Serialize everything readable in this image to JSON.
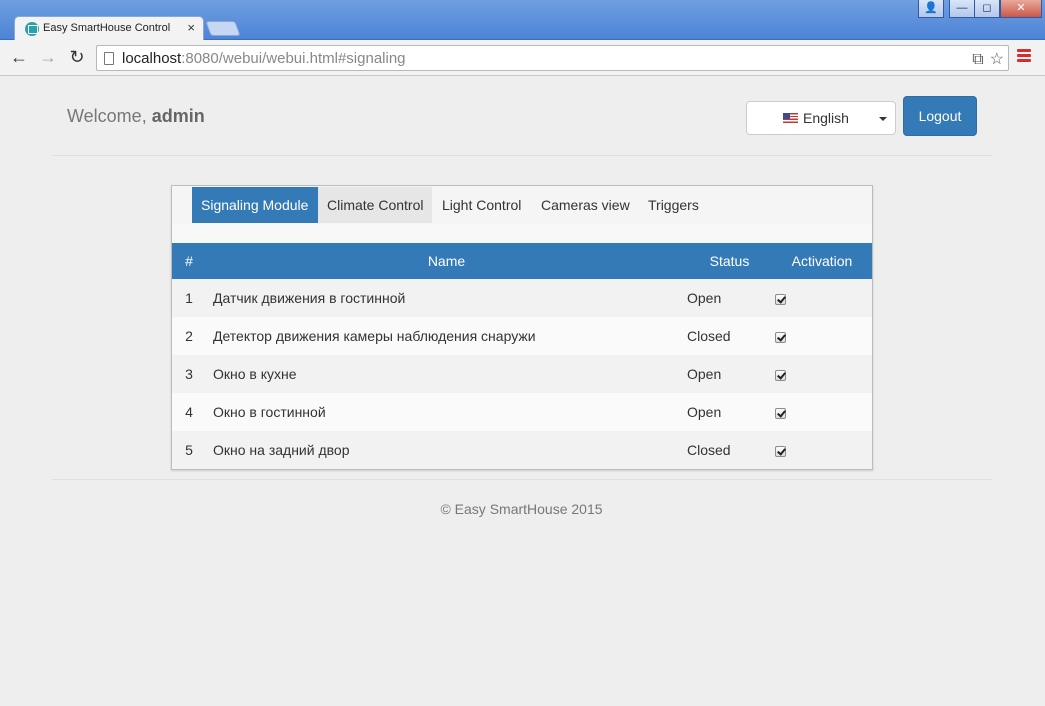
{
  "browser": {
    "tab_title": "Easy SmartHouse Control",
    "tab_close": "×",
    "url_host": "localhost",
    "url_rest": ":8080/webui/webui.html#signaling",
    "window_buttons": [
      "👤",
      "—",
      "◻",
      "✕"
    ]
  },
  "header": {
    "welcome_prefix": "Welcome, ",
    "username": "admin",
    "language": "English",
    "logout_label": "Logout"
  },
  "tabs": [
    {
      "label": "Signaling Module",
      "state": "active"
    },
    {
      "label": "Climate Control",
      "state": "hover"
    },
    {
      "label": "Light Control",
      "state": "normal"
    },
    {
      "label": "Cameras view",
      "state": "normal"
    },
    {
      "label": "Triggers",
      "state": "normal"
    }
  ],
  "table": {
    "headers": {
      "num": "#",
      "name": "Name",
      "status": "Status",
      "activation": "Activation"
    },
    "rows": [
      {
        "num": "1",
        "name": "Датчик движения в гостинной",
        "status": "Open",
        "active": true
      },
      {
        "num": "2",
        "name": "Детектор движения камеры наблюдения снаружи",
        "status": "Closed",
        "active": true
      },
      {
        "num": "3",
        "name": "Окно в кухне",
        "status": "Open",
        "active": true
      },
      {
        "num": "4",
        "name": "Окно в гостинной",
        "status": "Open",
        "active": true
      },
      {
        "num": "5",
        "name": "Окно на задний двор",
        "status": "Closed",
        "active": true
      }
    ]
  },
  "footer": {
    "text": "© Easy SmartHouse 2015"
  },
  "colors": {
    "primary": "#337ab7",
    "background": "#eeeeee"
  }
}
